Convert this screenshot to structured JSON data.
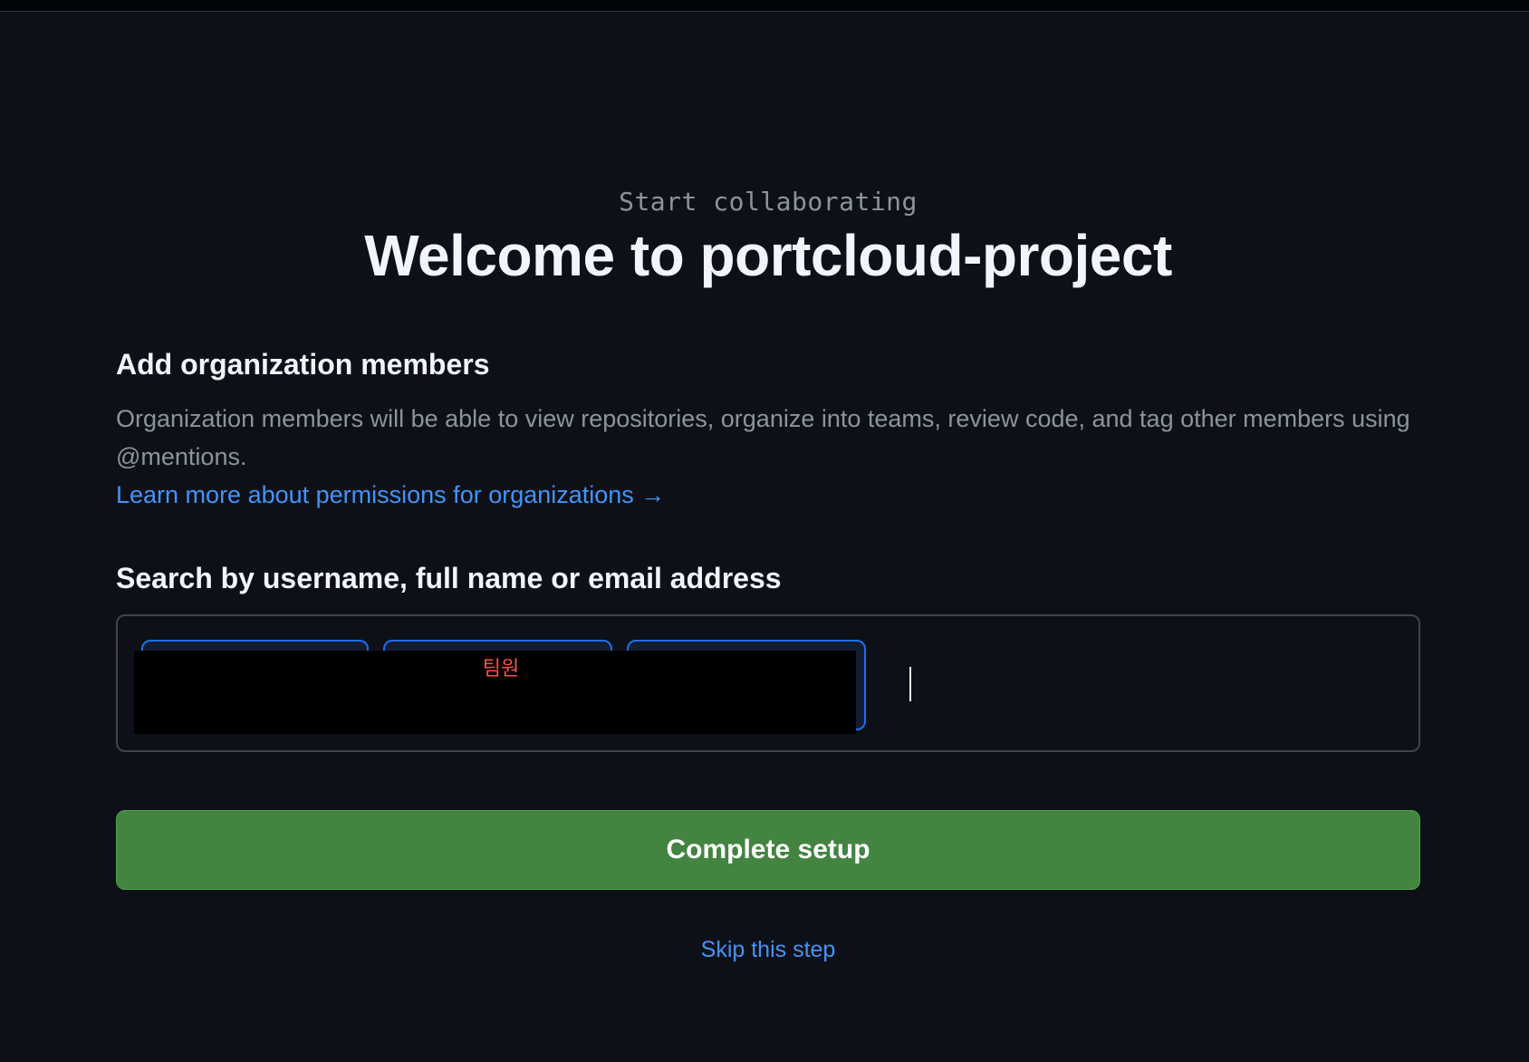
{
  "header": {
    "eyebrow": "Start collaborating",
    "title": "Welcome to portcloud-project"
  },
  "members_section": {
    "heading": "Add organization members",
    "description": "Organization members will be able to view repositories, organize into teams, review code, and tag other members using @mentions.",
    "learn_more_label": "Learn more about permissions for organizations →"
  },
  "search": {
    "label": "Search by username, full name or email address",
    "value": "",
    "chips": [
      {
        "role": ""
      },
      {
        "role": "팀원"
      },
      {
        "role": ""
      }
    ]
  },
  "actions": {
    "complete_label": "Complete setup",
    "skip_label": "Skip this step"
  },
  "colors": {
    "background": "#0d1117",
    "primary_button": "#428440",
    "link": "#4493f8",
    "chip_border": "#1f6feb",
    "role_text": "#f85149"
  }
}
